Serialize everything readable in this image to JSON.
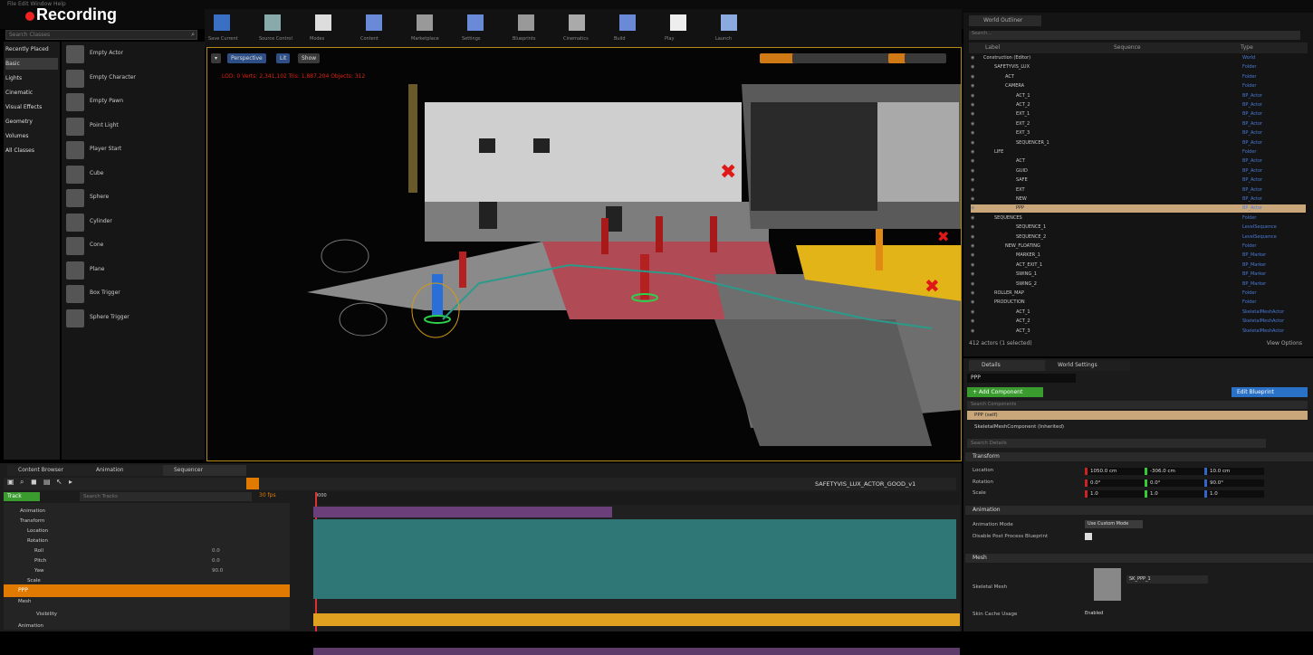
{
  "app": {
    "title": "Recording",
    "menu_text": "File  Edit  Window  Help"
  },
  "place_panel": {
    "search_placeholder": "Search Classes",
    "categories": [
      "Recently Placed",
      "Basic",
      "Lights",
      "Cinematic",
      "Visual Effects",
      "Geometry",
      "Volumes",
      "All Classes"
    ],
    "items": [
      "Empty Actor",
      "Empty Character",
      "Empty Pawn",
      "Point Light",
      "Player Start",
      "Cube",
      "Sphere",
      "Cylinder",
      "Cone",
      "Plane",
      "Box Trigger",
      "Sphere Trigger"
    ]
  },
  "toolbar": {
    "buttons": [
      "Save Current",
      "Source Control",
      "Modes",
      "Content",
      "Marketplace",
      "Settings",
      "Blueprints",
      "Cinematics",
      "Build",
      "Play",
      "Launch"
    ]
  },
  "viewport": {
    "perspective_label": "Perspective",
    "lit_label": "Lit",
    "show_label": "Show",
    "stats_text": "LOD: 0  Verts: 2,341,102  Tris: 1,887,204  Objects: 312"
  },
  "outliner": {
    "tab_label": "World Outliner",
    "search_placeholder": "Search...",
    "col_label": "Label",
    "col_sequence": "Sequence",
    "col_type": "Type",
    "rows": [
      {
        "label": "Construction (Editor)",
        "type": "World",
        "indent": 0
      },
      {
        "label": "SAFETYVIS_LUX",
        "type": "Folder",
        "indent": 1
      },
      {
        "label": "ACT",
        "type": "Folder",
        "indent": 2
      },
      {
        "label": "CAMERA",
        "type": "Folder",
        "indent": 2
      },
      {
        "label": "ACT_1",
        "type": "BP_Actor",
        "indent": 3
      },
      {
        "label": "ACT_2",
        "type": "BP_Actor",
        "indent": 3
      },
      {
        "label": "EXT_1",
        "type": "BP_Actor",
        "indent": 3
      },
      {
        "label": "EXT_2",
        "type": "BP_Actor",
        "indent": 3
      },
      {
        "label": "EXT_3",
        "type": "BP_Actor",
        "indent": 3
      },
      {
        "label": "SEQUENCER_1",
        "type": "BP_Actor",
        "indent": 3
      },
      {
        "label": "LIFE",
        "type": "Folder",
        "indent": 1
      },
      {
        "label": "ACT",
        "type": "BP_Actor",
        "indent": 3
      },
      {
        "label": "GUID",
        "type": "BP_Actor",
        "indent": 3
      },
      {
        "label": "SAFE",
        "type": "BP_Actor",
        "indent": 3
      },
      {
        "label": "EXT",
        "type": "BP_Actor",
        "indent": 3
      },
      {
        "label": "NEW",
        "type": "BP_Actor",
        "indent": 3
      },
      {
        "label": "PPP",
        "type": "BP_Actor",
        "indent": 3,
        "selected": true
      },
      {
        "label": "SEQUENCES",
        "type": "Folder",
        "indent": 1
      },
      {
        "label": "SEQUENCE_1",
        "type": "LevelSequence",
        "indent": 3
      },
      {
        "label": "SEQUENCE_2",
        "type": "LevelSequence",
        "indent": 3
      },
      {
        "label": "NEW_FLOATING",
        "type": "Folder",
        "indent": 2
      },
      {
        "label": "MARKER_1",
        "type": "BP_Marker",
        "indent": 3
      },
      {
        "label": "ACT_EXIT_1",
        "type": "BP_Marker",
        "indent": 3
      },
      {
        "label": "SWING_1",
        "type": "BP_Marker",
        "indent": 3
      },
      {
        "label": "SWING_2",
        "type": "BP_Marker",
        "indent": 3
      },
      {
        "label": "ROLLER_MAP",
        "type": "Folder",
        "indent": 1
      },
      {
        "label": "PRODUCTION",
        "type": "Folder",
        "indent": 1
      },
      {
        "label": "ACT_1",
        "type": "SkeletalMeshActor",
        "indent": 3
      },
      {
        "label": "ACT_2",
        "type": "SkeletalMeshActor",
        "indent": 3
      },
      {
        "label": "ACT_3",
        "type": "SkeletalMeshActor",
        "indent": 3
      }
    ],
    "footer": "412 actors (1 selected)",
    "view_options": "View Options"
  },
  "details": {
    "tab_details": "Details",
    "tab_world": "World Settings",
    "name_value": "PPP",
    "add_component": "+ Add Component",
    "edit_blueprint": "Edit Blueprint",
    "search_components": "Search Components",
    "component_self": "PPP (self)",
    "component_root": "SkeletalMeshComponent (Inherited)",
    "search_details": "Search Details",
    "sections": {
      "transform": "Transform",
      "animation": "Animation",
      "mesh": "Mesh"
    },
    "location_label": "Location",
    "rotation_label": "Rotation",
    "scale_label": "Scale",
    "location": [
      "1050.0 cm",
      "-306.0 cm",
      "10.0 cm"
    ],
    "rotation": [
      "0.0°",
      "0.0°",
      "90.0°"
    ],
    "scale": [
      "1.0",
      "1.0",
      "1.0"
    ],
    "anim_mode_label": "Animation Mode",
    "anim_mode_value": "Use Custom Mode",
    "anim_update_label": "Disable Post Process Blueprint",
    "mesh_label": "Skeletal Mesh",
    "mesh_value": "SK_PPP_1",
    "clothing_label": "Skin Cache Usage",
    "clothing_value": "Enabled"
  },
  "sequencer": {
    "tabs": [
      "Content Browser",
      "Animation",
      "Sequencer"
    ],
    "track_button": "Track",
    "filter_placeholder": "Search Tracks",
    "sequence_name": "SAFETYVIS_LUX_ACTOR_GOOD_v1",
    "fps": "30 fps",
    "tracks": [
      {
        "label": "Animation",
        "indent": 1
      },
      {
        "label": "Transform",
        "indent": 1
      },
      {
        "label": "Location",
        "indent": 2
      },
      {
        "label": "Rotation",
        "indent": 2
      },
      {
        "label": "Roll",
        "indent": 3,
        "value": "0.0"
      },
      {
        "label": "Pitch",
        "indent": 3,
        "value": "0.0"
      },
      {
        "label": "Yaw",
        "indent": 3,
        "value": "90.0"
      },
      {
        "label": "Scale",
        "indent": 2
      }
    ],
    "orange_row": "PPP",
    "sub_rows": [
      "Mesh",
      "Visibility",
      "Animation"
    ],
    "timecode": "0000"
  }
}
